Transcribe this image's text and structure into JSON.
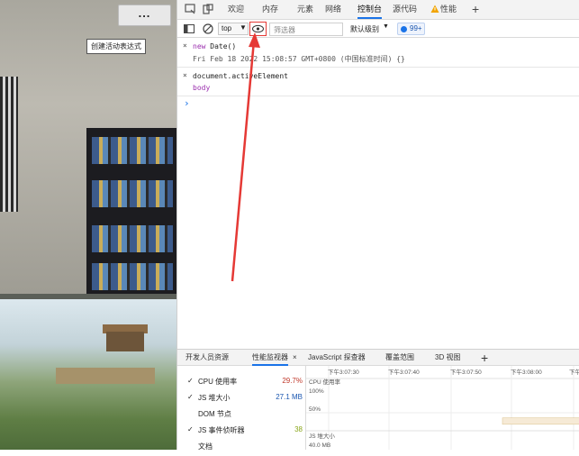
{
  "page": {
    "more_button": "..."
  },
  "devtools": {
    "tabs": [
      "欢迎",
      "内存",
      "元素",
      "网络",
      "控制台",
      "源代码",
      "性能"
    ],
    "active_tab": "控制台",
    "toolbar": {
      "context": "top",
      "filter_placeholder": "筛选器",
      "level": "默认级别",
      "issues_count": "99+",
      "live_expression_tooltip": "创建活动表达式"
    },
    "console": {
      "entries": [
        {
          "input": "new Date()",
          "output": "Fri Feb 18 2022 15:08:57 GMT+0800 (中国标准时间) {}"
        },
        {
          "input": "document.activeElement",
          "output": "body"
        }
      ],
      "prompt": "›"
    },
    "drawer": {
      "tabs": [
        "开发人员资源",
        "性能监视器",
        "JavaScript 探查器",
        "覆盖范围",
        "3D 视图"
      ],
      "active_tab": "性能监视器",
      "close_glyph": "×",
      "add_glyph": "+"
    },
    "perf_monitor": {
      "metrics": [
        {
          "label": "CPU 使用率",
          "value": "29.7%",
          "checked": true,
          "color": "#c0392b"
        },
        {
          "label": "JS 堆大小",
          "value": "27.1 MB",
          "checked": true,
          "color": "#1a56b0"
        },
        {
          "label": "DOM 节点",
          "value": "",
          "checked": false,
          "color": "#333333"
        },
        {
          "label": "JS 事件侦听器",
          "value": "38",
          "checked": true,
          "color": "#8aa61a"
        },
        {
          "label": "文档",
          "value": "",
          "checked": false,
          "color": "#333333"
        }
      ],
      "time_labels": [
        "下午3:07:30",
        "下午3:07:40",
        "下午3:07:50",
        "下午3:08:00",
        "下午3:08:"
      ],
      "cpu_chart_label": "CPU 使用率",
      "cpu_ticks": [
        "100%",
        "50%"
      ],
      "heap_chart_label": "JS 堆大小",
      "heap_tick": "40.0 MB",
      "cpu_level_percent": 29.7
    },
    "accent_color": "#1a73e8",
    "arrow_color": "#e53935"
  }
}
